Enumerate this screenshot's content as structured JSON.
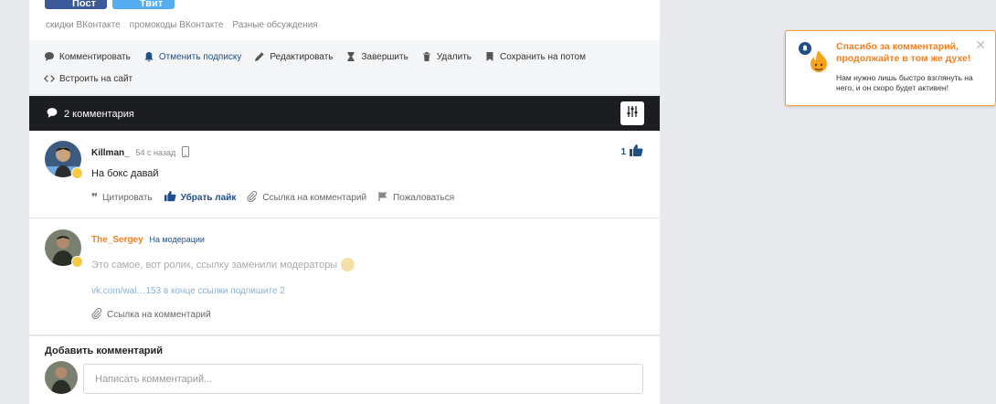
{
  "share": {
    "fb_label": "Пост",
    "tw_label": "Твит"
  },
  "tags": [
    "скидки ВКонтакте",
    "промокоды ВКонтакте",
    "Разные обсуждения"
  ],
  "actions": {
    "comment": "Комментировать",
    "unsubscribe": "Отменить подписку",
    "edit": "Редактировать",
    "finish": "Завершить",
    "delete": "Удалить",
    "save_later": "Сохранить на потом",
    "embed": "Встроить на сайт"
  },
  "comments_header": {
    "title": "2 комментария"
  },
  "comments": [
    {
      "author": "Killman_",
      "meta": "54 с назад",
      "text": "На бокс давай",
      "likes": "1",
      "quote": "Цитировать",
      "unlike": "Убрать лайк",
      "link": "Ссылка на комментарий",
      "report": "Пожаловаться"
    },
    {
      "author": "The_Sergey",
      "status": "На модерации",
      "text": "Это самое, вот ролик, ссылку заменили модераторы",
      "link_text": "vk.com/wal…153 в конце ссылки подпишите 2",
      "link": "Ссылка на комментарий"
    }
  ],
  "add_comment": {
    "title": "Добавить комментарий",
    "placeholder": "Написать комментарий..."
  },
  "toast": {
    "title": "Спасибо за комментарий, продолжайте в том же духе!",
    "body": "Нам нужно лишь быстро взглянуть на него, и он скоро будет активен!"
  },
  "colors": {
    "accent": "#1e4f86",
    "orange": "#f08025",
    "header_bg": "#1c1d21"
  }
}
